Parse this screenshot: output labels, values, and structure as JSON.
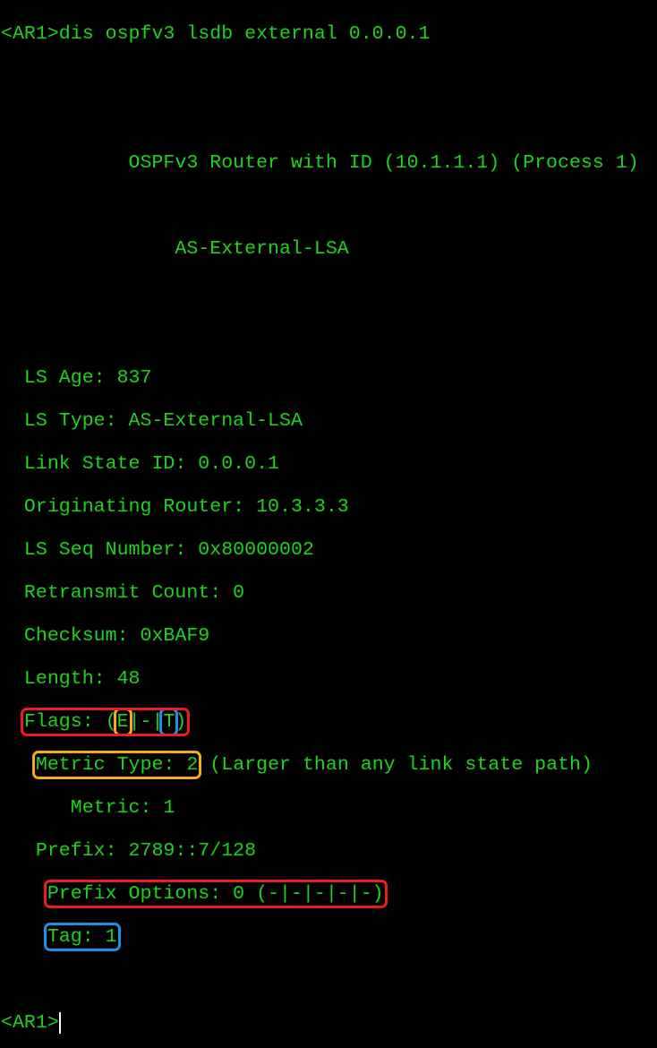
{
  "command_line": "<AR1>dis ospfv3 lsdb external 0.0.0.1",
  "header": "           OSPFv3 Router with ID (10.1.1.1) (Process 1)",
  "lsa_title": "               AS-External-LSA",
  "fields": [
    "  LS Age: 837",
    "  LS Type: AS-External-LSA",
    "  Link State ID: 0.0.0.1",
    "  Originating Router: 10.3.3.3",
    "  LS Seq Number: 0x80000002",
    "  Retransmit Count: 0",
    "  Checksum: 0xBAF9",
    "  Length: 48"
  ],
  "flags": {
    "label": "Flags: (",
    "e": "E",
    "mid": "|-|",
    "t": "T",
    "end": ")"
  },
  "metric_type": {
    "label": "Metric Type: 2",
    "note": " (Larger than any link state path)"
  },
  "metric": "      Metric: 1",
  "prefix": "   Prefix: 2789::7/128",
  "prefix_options": "Prefix Options: 0 (-|-|-|-|-)",
  "tag": "Tag: 1",
  "prompt": "<AR1>",
  "colors": {
    "text": "#1cd41c",
    "highlight_red": "#f01c1c",
    "highlight_orange": "#f5ac14",
    "highlight_blue": "#1e8fe6"
  }
}
